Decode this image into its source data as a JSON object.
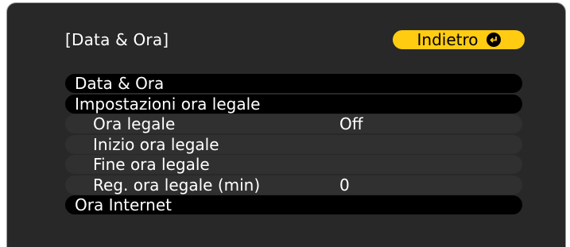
{
  "header": {
    "title": "[Data & Ora]",
    "back_label": "Indietro",
    "back_icon": "enter-icon"
  },
  "menu": {
    "items": [
      {
        "label": "Data & Ora",
        "value": ""
      },
      {
        "label": "Impostazioni ora legale",
        "value": ""
      },
      {
        "label": "Ora legale",
        "value": "Off"
      },
      {
        "label": "Inizio ora legale",
        "value": ""
      },
      {
        "label": "Fine ora legale",
        "value": ""
      },
      {
        "label": "Reg. ora legale (min)",
        "value": "0"
      },
      {
        "label": "Ora Internet",
        "value": ""
      }
    ]
  },
  "colors": {
    "background": "#282828",
    "button": "#ffcc11",
    "main_row": "#000000",
    "sub_row": "#303030",
    "text": "#ffffff"
  }
}
